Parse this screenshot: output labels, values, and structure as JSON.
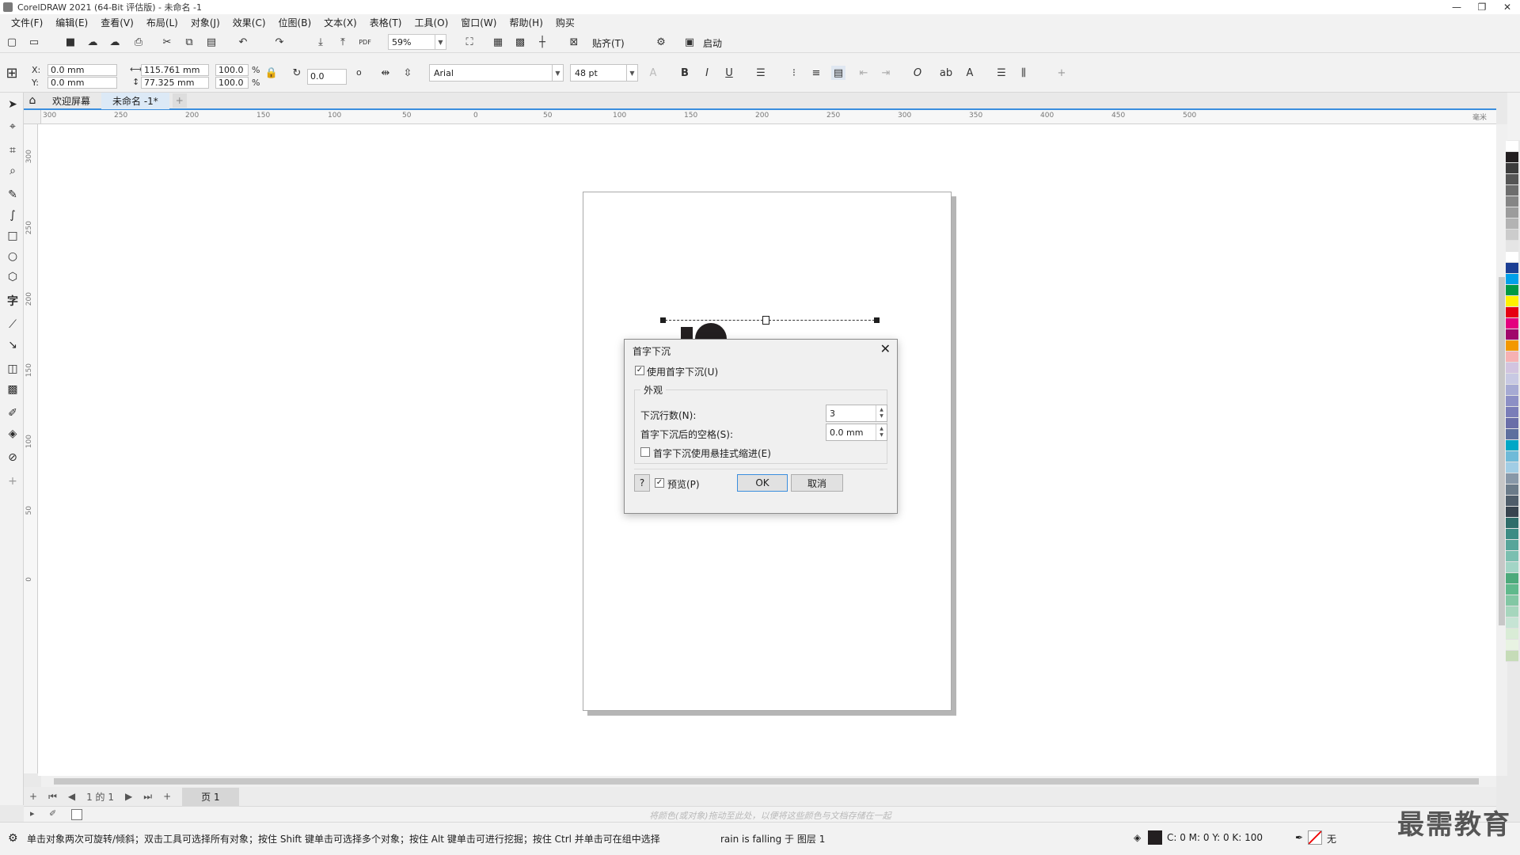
{
  "window": {
    "title": "CorelDRAW 2021 (64-Bit 评估版) - 未命名 -1",
    "controls": {
      "minimize": "—",
      "restore": "❐",
      "close": "✕"
    }
  },
  "menu": [
    "文件(F)",
    "编辑(E)",
    "查看(V)",
    "布局(L)",
    "对象(J)",
    "效果(C)",
    "位图(B)",
    "文本(X)",
    "表格(T)",
    "工具(O)",
    "窗口(W)",
    "帮助(H)",
    "购买"
  ],
  "standard_toolbar": {
    "zoom": "59%",
    "snap_label": "贴齐(T)",
    "launch_label": "启动",
    "pdf_label": "PDF"
  },
  "property_bar": {
    "x_label": "X:",
    "y_label": "Y:",
    "x_value": "0.0 mm",
    "y_value": "0.0 mm",
    "width_value": "115.761 mm",
    "height_value": "77.325 mm",
    "scale_w": "100.0",
    "scale_h": "100.0",
    "percent": "%",
    "rotation": "0.0",
    "degree": "o",
    "font": "Arial",
    "font_size": "48 pt"
  },
  "tabs": {
    "welcome": "欢迎屏幕",
    "document": "未命名 -1*"
  },
  "ruler_h_ticks": [
    "300",
    "250",
    "200",
    "150",
    "100",
    "50",
    "0",
    "50",
    "100",
    "150",
    "200",
    "250",
    "300",
    "350",
    "400",
    "450",
    "500"
  ],
  "ruler_unit": "毫米",
  "ruler_v_ticks": [
    "300",
    "250",
    "200",
    "150",
    "100",
    "50",
    "0"
  ],
  "dialog": {
    "title": "首字下沉",
    "use_dropcap": "使用首字下沉(U)",
    "appearance": "外观",
    "lines_label": "下沉行数(N):",
    "lines_value": "3",
    "space_label": "首字下沉后的空格(S):",
    "space_value": "0.0 mm",
    "hanging_label": "首字下沉使用悬挂式缩进(E)",
    "help": "?",
    "preview": "预览(P)",
    "ok": "OK",
    "cancel": "取消"
  },
  "page_nav": {
    "page_of": "1 的 1",
    "page_tab": "页 1"
  },
  "docker_hint": "将颜色(或对象)拖动至此处，以便将这些颜色与文档存储在一起",
  "status": {
    "hint": "单击对象两次可旋转/倾斜；双击工具可选择所有对象；按住 Shift 键单击可选择多个对象；按住 Alt 键单击可进行挖掘；按住 Ctrl 并单击可在组中选择",
    "object": "rain is falling 于 图层 1",
    "fill": "C: 0 M: 0 Y: 0 K: 100",
    "outline": "无"
  },
  "watermark": "最需教育",
  "palette": [
    "#ffffff",
    "#231f20",
    "#3c3c3c",
    "#555555",
    "#6d6d6d",
    "#858585",
    "#9c9c9c",
    "#b3b3b3",
    "#cccccc",
    "#e5e5e5",
    "#ffffff",
    "#1c3f94",
    "#00a0e9",
    "#009944",
    "#fff100",
    "#e60012",
    "#e4007f",
    "#a0076b",
    "#f39800",
    "#f6b1b3",
    "#d2c4e0",
    "#c8c9e3",
    "#a6aad3",
    "#8c8fc5",
    "#7a7db8",
    "#6a6ea8",
    "#5d6f9e",
    "#00a7c6",
    "#6fbad8",
    "#a1cde5",
    "#8898a8",
    "#6b7b89",
    "#4f5d6a",
    "#38444f",
    "#2f6d6a",
    "#3d8c84",
    "#58a59a",
    "#7bbfb0",
    "#a3d5c6",
    "#4caa7b",
    "#5fb98c",
    "#82c7a4",
    "#a6d6bd",
    "#c6e4d4",
    "#d9ecd6",
    "#e8f3e2",
    "#c6dcb8"
  ],
  "colors": {
    "accent": "#3a8ede",
    "dropcap_fill": "#231f20"
  }
}
